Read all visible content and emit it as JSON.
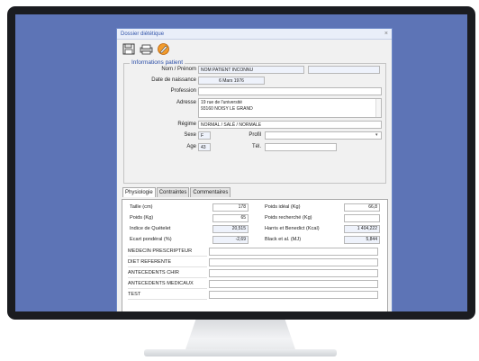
{
  "window": {
    "title": "Dossier diététique",
    "close": "×"
  },
  "toolbar": {
    "icons": [
      "floppy-disk-icon",
      "printer-icon",
      "pen-icon"
    ]
  },
  "patient": {
    "group_title": "Informations patient",
    "nom_label": "Nom / Prénom",
    "nom_value": "NOM PATIENT INCONNU",
    "naissance_label": "Date de naissance",
    "naissance_value": "6 Mars 1976",
    "profession_label": "Profession",
    "profession_value": "",
    "adresse_label": "Adresse",
    "adresse_line1": "19 rue de l'université",
    "adresse_line2": "93160 NOISY LE GRAND",
    "regime_label": "Régime",
    "regime_value": "NORMAL / SALÉ / NORMALE",
    "sexe_label": "Sexe",
    "sexe_value": "F",
    "profil_label": "Profil",
    "profil_value": "",
    "age_label": "Age",
    "age_value": "43",
    "tel_label": "Tél.",
    "tel_value": ""
  },
  "tabs": [
    {
      "label": "Physiologie",
      "active": true
    },
    {
      "label": "Contraintes",
      "active": false
    },
    {
      "label": "Commentaires",
      "active": false
    }
  ],
  "physio": {
    "taille_label": "Taille (cm)",
    "taille_value": "178",
    "poids_label": "Poids (Kg)",
    "poids_value": "65",
    "quetelet_label": "Indice de Quételet",
    "quetelet_value": "20,515",
    "ecart_label": "Ecart pondéral (%)",
    "ecart_value": "-2,69",
    "poids_ideal_label": "Poids idéal (Kg)",
    "poids_ideal_value": "66,8",
    "poids_recherche_label": "Poids recherché (Kg)",
    "poids_recherche_value": "",
    "harris_label": "Harris et Benedict (Kcal)",
    "harris_value": "1 404,222",
    "black_label": "Black et al. (MJ)",
    "black_value": "5,844"
  },
  "extra_fields": [
    {
      "label": "MEDECIN PRESCRIPTEUR",
      "value": ""
    },
    {
      "label": "DIET REFERENTE",
      "value": ""
    },
    {
      "label": "ANTECEDENTS CHIR",
      "value": ""
    },
    {
      "label": "ANTECEDENTS MEDICAUX",
      "value": ""
    },
    {
      "label": "TEST",
      "value": ""
    }
  ]
}
